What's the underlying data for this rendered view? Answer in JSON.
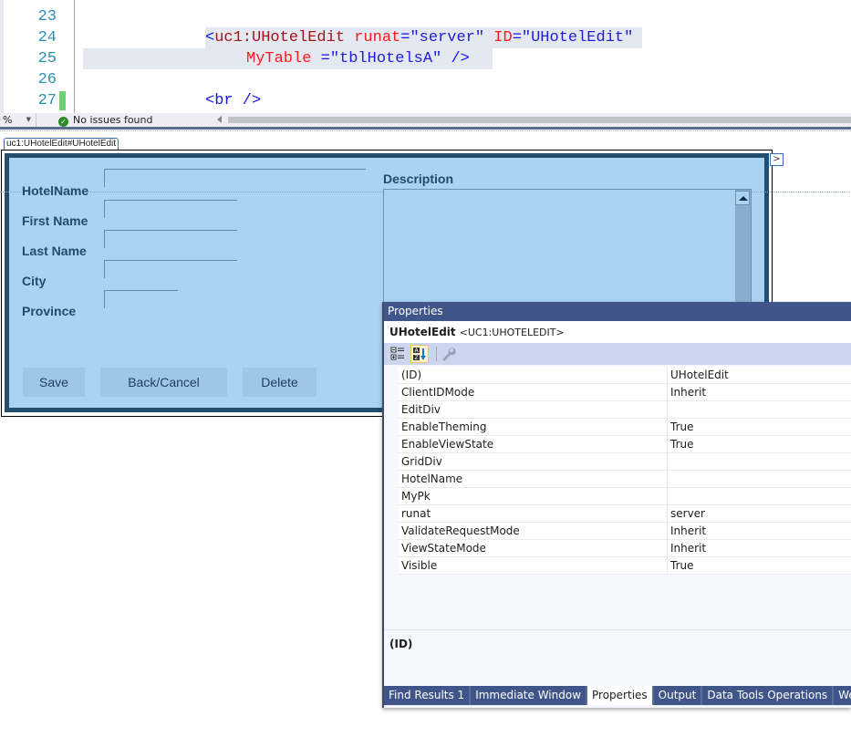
{
  "editor": {
    "lines": [
      {
        "number": "23",
        "text": ""
      },
      {
        "number": "24",
        "tag_open": "<",
        "element": "uc1:UHotelEdit",
        "attr1": "runat",
        "eq1": "=",
        "val1": "\"server\"",
        "attr2": "ID",
        "eq2": "=",
        "val2": "\"UHotelEdit\""
      },
      {
        "number": "25",
        "attr": "MyTable",
        "eq": " =",
        "val": "\"tblHotelsA\"",
        "close": " />"
      },
      {
        "number": "26",
        "text": ""
      },
      {
        "number": "27",
        "tag": "<br />"
      }
    ],
    "statusbar": {
      "zoom": "%",
      "issues": "No issues found"
    }
  },
  "designer": {
    "control_tag": "uc1:UHotelEdit#UHotelEdit",
    "smart_tag": ">",
    "fields": [
      {
        "label": "HotelName",
        "value": ""
      },
      {
        "label": "First Name",
        "value": ""
      },
      {
        "label": "Last Name",
        "value": ""
      },
      {
        "label": "City",
        "value": ""
      },
      {
        "label": "Province",
        "value": ""
      }
    ],
    "description_label": "Description",
    "buttons": {
      "save": "Save",
      "back_cancel": "Back/Cancel",
      "delete": "Delete"
    }
  },
  "properties": {
    "title": "Properties",
    "object_name": "UHotelEdit",
    "object_type": "<UC1:UHOTELEDIT>",
    "toolbar": {
      "categorized": "categorized-icon",
      "alphabetical": "alphabetical-sort-icon",
      "property_pages": "wrench-icon"
    },
    "rows": [
      {
        "name": "(ID)",
        "value": "UHotelEdit"
      },
      {
        "name": "ClientIDMode",
        "value": "Inherit"
      },
      {
        "name": "EditDiv",
        "value": ""
      },
      {
        "name": "EnableTheming",
        "value": "True"
      },
      {
        "name": "EnableViewState",
        "value": "True"
      },
      {
        "name": "GridDiv",
        "value": ""
      },
      {
        "name": "HotelName",
        "value": ""
      },
      {
        "name": "MyPk",
        "value": ""
      },
      {
        "name": "runat",
        "value": "server"
      },
      {
        "name": "ValidateRequestMode",
        "value": "Inherit"
      },
      {
        "name": "ViewStateMode",
        "value": "Inherit"
      },
      {
        "name": "Visible",
        "value": "True"
      }
    ],
    "description_title": "(ID)",
    "tabs": [
      {
        "label": "Find Results 1",
        "active": false
      },
      {
        "label": "Immediate Window",
        "active": false
      },
      {
        "label": "Properties",
        "active": true
      },
      {
        "label": "Output",
        "active": false
      },
      {
        "label": "Data Tools Operations",
        "active": false
      },
      {
        "label": "Web Publish",
        "active": false
      }
    ]
  }
}
